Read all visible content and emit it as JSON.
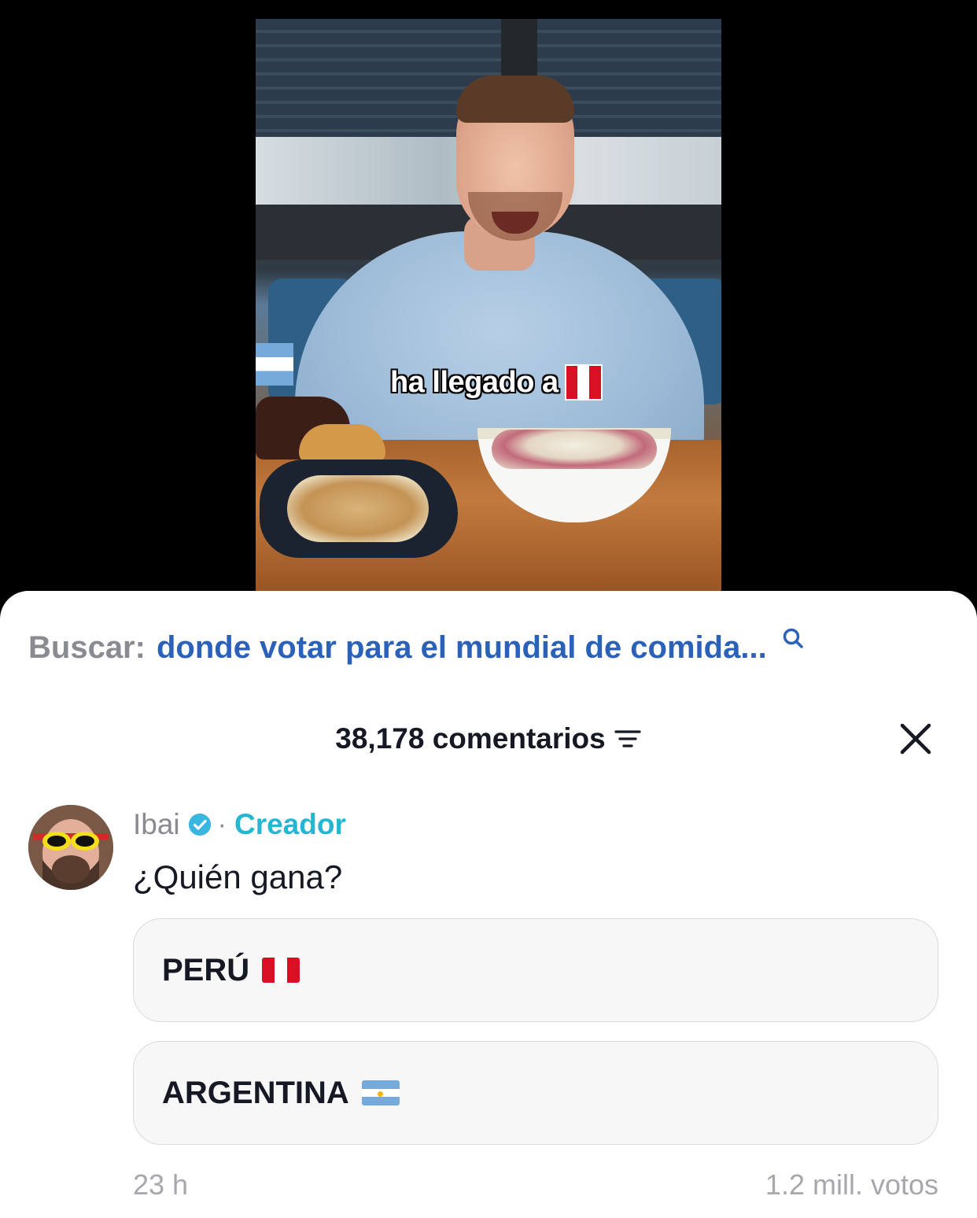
{
  "video": {
    "caption": "ha llegado a",
    "caption_flag": "peru-flag-icon"
  },
  "search": {
    "prefix": "Buscar:",
    "query": "donde votar para el mundial de comida..."
  },
  "comments_header": {
    "count_label": "38,178 comentarios"
  },
  "comment": {
    "author": "Ibai",
    "badge": "verified-icon",
    "separator": "·",
    "role": "Creador",
    "text": "¿Quién gana?",
    "timestamp": "23 h",
    "votes": "1.2 mill. votos"
  },
  "poll": {
    "options": [
      {
        "label": "PERÚ",
        "flag": "peru-flag-icon"
      },
      {
        "label": "ARGENTINA",
        "flag": "argentina-flag-icon"
      }
    ]
  },
  "colors": {
    "link_blue": "#2b61b8",
    "creator_teal": "#25b6d2",
    "muted_gray": "#8a8b91",
    "text_dark": "#161823",
    "peru_red": "#d91023",
    "argentina_blue": "#75aadb"
  }
}
